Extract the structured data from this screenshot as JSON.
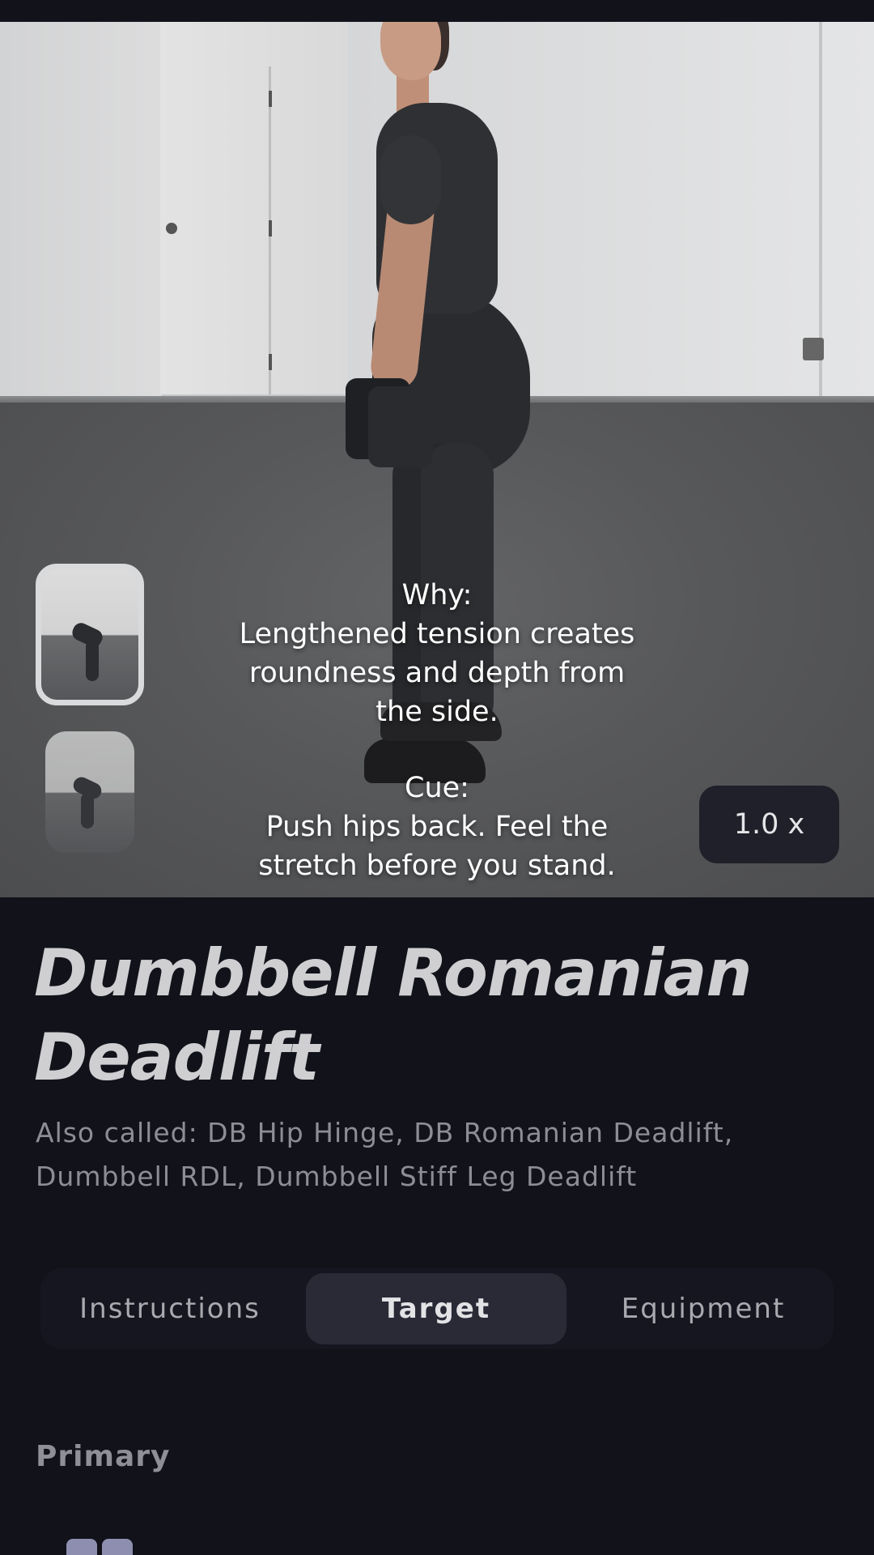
{
  "video": {
    "why_heading": "Why:",
    "why_text": "Lengthened tension creates roundness and depth from the side.",
    "cue_heading": "Cue:",
    "cue_text": "Push hips back. Feel the stretch before you stand.",
    "speed_label": "1.0 x"
  },
  "exercise": {
    "title": "Dumbbell Romanian Deadlift",
    "also_called": "Also called: DB Hip Hinge, DB Romanian Deadlift, Dumbbell RDL, Dumbbell Stiff Leg Deadlift"
  },
  "tabs": [
    {
      "label": "Instructions",
      "selected": false
    },
    {
      "label": "Target",
      "selected": true
    },
    {
      "label": "Equipment",
      "selected": false
    }
  ],
  "target": {
    "section_heading": "Primary"
  },
  "icons": {
    "muscle": "muscle-group-icon"
  }
}
